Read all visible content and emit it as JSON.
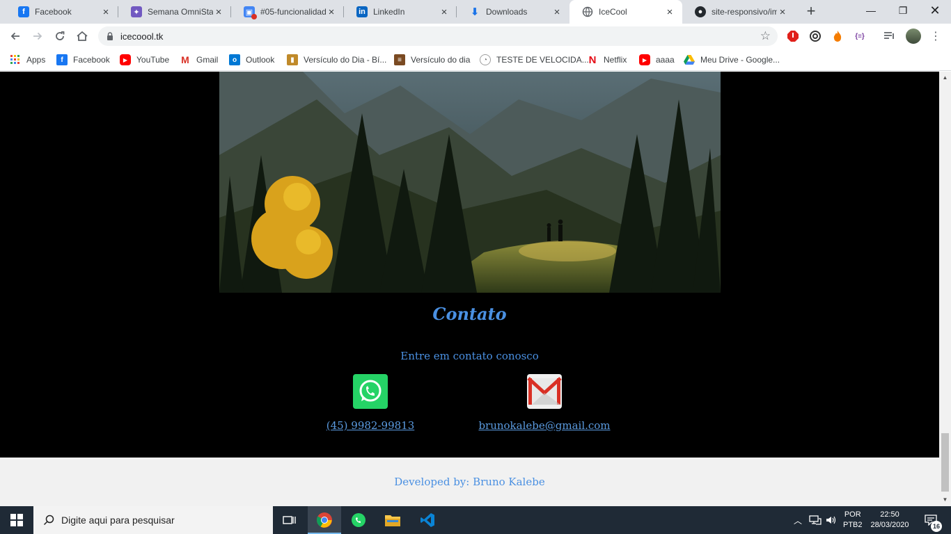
{
  "browser": {
    "tabs": [
      {
        "title": "Facebook",
        "favicon": "facebook-icon",
        "color": "#1877f2"
      },
      {
        "title": "Semana OmniStac",
        "favicon": "omnistack-icon",
        "color": "#7159c1"
      },
      {
        "title": "#05-funcionalidad",
        "favicon": "google-classroom-icon",
        "color": "#4285f4"
      },
      {
        "title": "LinkedIn",
        "favicon": "linkedin-icon",
        "color": "#0a66c2"
      },
      {
        "title": "Downloads",
        "favicon": "download-icon",
        "color": "#1a73e8"
      },
      {
        "title": "IceCool",
        "favicon": "globe-icon",
        "color": "#5f6368"
      },
      {
        "title": "site-responsivo/im",
        "favicon": "github-icon",
        "color": "#24292e"
      }
    ],
    "url": "icecoool.tk"
  },
  "bookmarks": [
    {
      "label": "Apps",
      "icon": "apps-grid-icon"
    },
    {
      "label": "Facebook",
      "icon": "facebook-icon",
      "color": "#1877f2"
    },
    {
      "label": "YouTube",
      "icon": "youtube-icon",
      "color": "#ff0000"
    },
    {
      "label": "Gmail",
      "icon": "gmail-icon",
      "color": "#d93025"
    },
    {
      "label": "Outlook",
      "icon": "outlook-icon",
      "color": "#0078d4"
    },
    {
      "label": "Versículo do Dia - Bí...",
      "icon": "bible-icon",
      "color": "#c08a2a"
    },
    {
      "label": "Versículo do dia",
      "icon": "bible-icon",
      "color": "#7a4a22"
    },
    {
      "label": "TESTE DE VELOCIDA...",
      "icon": "speedtest-icon",
      "color": "#9e9e9e"
    },
    {
      "label": "Netflix",
      "icon": "netflix-icon",
      "color": "#e50914"
    },
    {
      "label": "aaaa",
      "icon": "youtube-icon",
      "color": "#ff0000"
    },
    {
      "label": "Meu Drive - Google...",
      "icon": "google-drive-icon",
      "color": "#0f9d58"
    }
  ],
  "page": {
    "contact_title": "Contato",
    "contact_subtitle": "Entre em contato conosco",
    "phone": "(45) 9982-99813",
    "email": "brunokalebe@gmail.com",
    "footer": "Developed by: Bruno Kalebe",
    "accent": "#4a90e2"
  },
  "taskbar": {
    "search_placeholder": "Digite aqui para pesquisar",
    "lang_top": "POR",
    "lang_bottom": "PTB2",
    "time": "22:50",
    "date": "28/03/2020",
    "notifications": "16"
  }
}
